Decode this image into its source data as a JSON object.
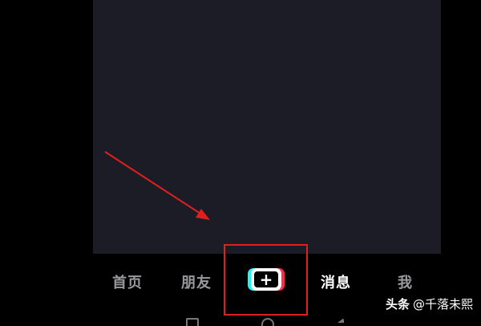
{
  "tabbar": {
    "home_label": "首页",
    "friends_label": "朋友",
    "create_label": "+",
    "messages_label": "消息",
    "me_label": "我"
  },
  "watermark": {
    "brand": "头条",
    "author": "@千落未熙"
  },
  "colors": {
    "background": "#000000",
    "video_area": "#1b1c26",
    "annotation_red": "#e0201d",
    "accent_cyan": "#25f4ee",
    "accent_pink": "#fe2c55"
  },
  "icons": [
    "plus-icon",
    "square-nav-icon",
    "circle-nav-icon",
    "back-nav-icon",
    "annotation-arrow-icon"
  ]
}
